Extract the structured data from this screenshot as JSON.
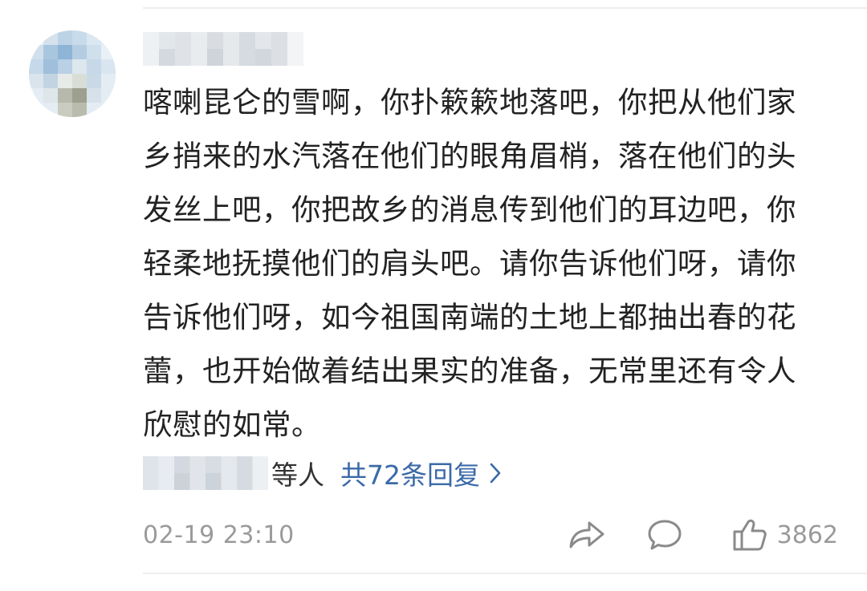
{
  "comment": {
    "text": "喀喇昆仑的雪啊，你扑簌簌地落吧，你把从他们家乡捎来的水汽落在他们的眼角眉梢，落在他们的头发丝上吧，你把故乡的消息传到他们的耳边吧，你轻柔地抚摸他们的肩头吧。请你告诉他们呀，请你告诉他们呀，如今祖国南端的土地上都抽出春的花蕾，也开始做着结出果实的准备，无常里还有令人欣慰的如常。",
    "timestamp": "02-19 23:10",
    "like_count": "3862"
  },
  "replies": {
    "suffix": "等人",
    "link_label": "共72条回复"
  },
  "icons": {
    "share": "share-arrow-icon",
    "reply": "speech-bubble-icon",
    "like": "thumbs-up-icon",
    "chevron": "chevron-right-icon"
  },
  "colors": {
    "link": "#3b6aa8",
    "text": "#222222",
    "meta": "#9a9a9a"
  }
}
